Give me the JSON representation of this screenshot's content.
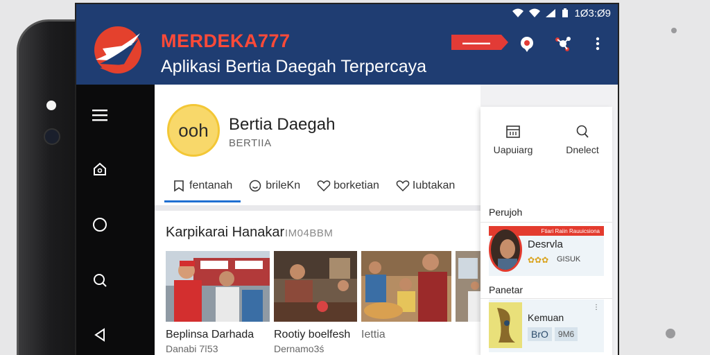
{
  "status": {
    "time": "1Ø3:Ø9"
  },
  "header": {
    "brand": "MERDEKA777",
    "tagline": "Aplikasi Bertia Daegah Terpercaya",
    "colors": {
      "appbar": "#1f3d72",
      "brand": "#ff4a38",
      "accent": "#1f6fd1"
    }
  },
  "sidebar": {
    "icons": [
      "menu-icon",
      "home-icon",
      "circle-icon",
      "search-icon",
      "back-icon"
    ]
  },
  "profile": {
    "avatar_text": "ooh",
    "title": "Bertia Daegah",
    "subtitle": "BERTIIA"
  },
  "tabs": [
    {
      "label": "fentanah",
      "icon": "bookmark-icon",
      "active": true
    },
    {
      "label": "brileKn",
      "icon": "smile-icon",
      "active": false
    },
    {
      "label": "borketian",
      "icon": "heart-icon",
      "active": false
    },
    {
      "label": "Iubtakan",
      "icon": "heart-icon",
      "active": false
    }
  ],
  "section": {
    "title": "Karpikarai Hanakar",
    "meta": "IM04BBM",
    "items": [
      {
        "title": "Beplinsa Darhada",
        "meta": "Danabi 7ī53"
      },
      {
        "title": "Rootiy boelfesh",
        "meta": "Dernamo3ś"
      },
      {
        "title": "Iettia",
        "meta": ""
      }
    ]
  },
  "panel": {
    "actions": [
      {
        "label": "Uapuiarg",
        "icon": "calendar-icon"
      },
      {
        "label": "Dnelect",
        "icon": "search-icon"
      }
    ],
    "section1_label": "Perujoh",
    "card1": {
      "name": "Desrvla",
      "meta": "GISUK",
      "band_text": "Ftiari Raiin Rauuicsiona"
    },
    "section2_label": "Panetar",
    "card2": {
      "name": "Kemuan",
      "badge1": "BrO",
      "badge2": "9M6"
    }
  }
}
